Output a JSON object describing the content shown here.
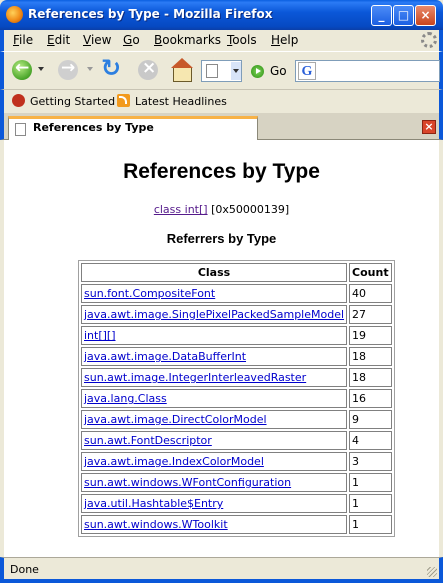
{
  "window": {
    "title": "References by Type - Mozilla Firefox",
    "min_label": "_",
    "max_label": "□",
    "close_label": "×"
  },
  "menu": [
    "File",
    "Edit",
    "View",
    "Go",
    "Bookmarks",
    "Tools",
    "Help"
  ],
  "menu_accel": [
    "F",
    "E",
    "V",
    "G",
    "B",
    "T",
    "H"
  ],
  "navbar": {
    "go_label": "Go",
    "search_engine_letter": "G"
  },
  "bookmarks": [
    "Getting Started",
    "Latest Headlines"
  ],
  "tab": {
    "label": "References by Type",
    "close_label": "×"
  },
  "page": {
    "title": "References by Type",
    "class_link": "class int[]",
    "class_address": "[0x50000139]",
    "subtitle": "Referrers by Type",
    "table": {
      "headers": [
        "Class",
        "Count"
      ],
      "rows": [
        [
          "sun.font.CompositeFont",
          "40"
        ],
        [
          "java.awt.image.SinglePixelPackedSampleModel",
          "27"
        ],
        [
          "int[][]",
          "19"
        ],
        [
          "java.awt.image.DataBufferInt",
          "18"
        ],
        [
          "sun.awt.image.IntegerInterleavedRaster",
          "18"
        ],
        [
          "java.lang.Class",
          "16"
        ],
        [
          "java.awt.image.DirectColorModel",
          "9"
        ],
        [
          "sun.awt.FontDescriptor",
          "4"
        ],
        [
          "java.awt.image.IndexColorModel",
          "3"
        ],
        [
          "sun.awt.windows.WFontConfiguration",
          "1"
        ],
        [
          "java.util.Hashtable$Entry",
          "1"
        ],
        [
          "sun.awt.windows.WToolkit",
          "1"
        ]
      ]
    }
  },
  "status": {
    "text": "Done"
  },
  "colors": {
    "titlebar": "#0b58d9",
    "link": "#0000cc",
    "visited_link": "#551a8b",
    "chrome": "#ece9d8"
  }
}
